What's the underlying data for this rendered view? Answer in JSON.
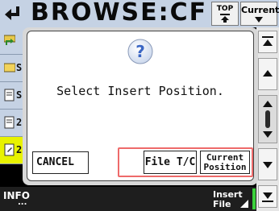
{
  "header": {
    "title": "BROWSE:CF",
    "top_label": "TOP",
    "current_label": "Current"
  },
  "list": {
    "rows": [
      {
        "icon": "folder-up-icon",
        "text": ""
      },
      {
        "icon": "folder-icon",
        "text": "S"
      },
      {
        "icon": "file-icon",
        "text": "S"
      },
      {
        "icon": "file-icon",
        "text": "2"
      },
      {
        "icon": "file-selected-icon",
        "text": "2"
      }
    ]
  },
  "dialog": {
    "icon": "question-icon",
    "message": "Select Insert Position.",
    "cancel_label": "CANCEL",
    "file_tc_label": "File T/C",
    "current_position_line1": "Current",
    "current_position_line2": "Position"
  },
  "footer": {
    "info_label": "INFO",
    "info_dots": "...",
    "insert_line1": "Insert",
    "insert_line2": "File"
  },
  "colors": {
    "header_bg": "#c5d2e4",
    "dialog_accent": "#ee6a6a",
    "question_blue": "#3a66c4",
    "indicator_green": "#3cd23c"
  }
}
